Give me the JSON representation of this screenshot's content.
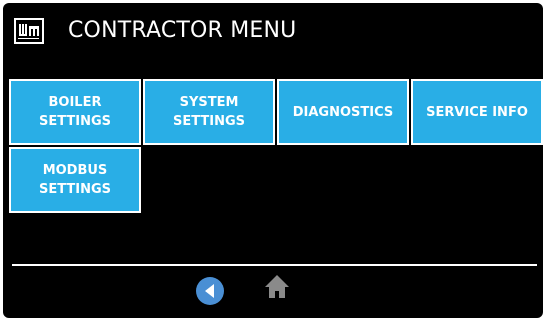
{
  "header": {
    "title": "CONTRACTOR MENU",
    "logo_icon": "wm-logo-icon"
  },
  "menu": {
    "buttons": [
      {
        "label": "BOILER\nSETTINGS"
      },
      {
        "label": "SYSTEM\nSETTINGS"
      },
      {
        "label": "DIAGNOSTICS"
      },
      {
        "label": "SERVICE INFO"
      },
      {
        "label": "MODBUS\nSETTINGS"
      }
    ]
  },
  "footer": {
    "back_icon": "back-arrow-icon",
    "home_icon": "home-icon"
  },
  "colors": {
    "background": "#000000",
    "button": "#29aee6",
    "back_button": "#4a8fd4",
    "home_icon": "#8a8a8a",
    "text": "#ffffff"
  }
}
